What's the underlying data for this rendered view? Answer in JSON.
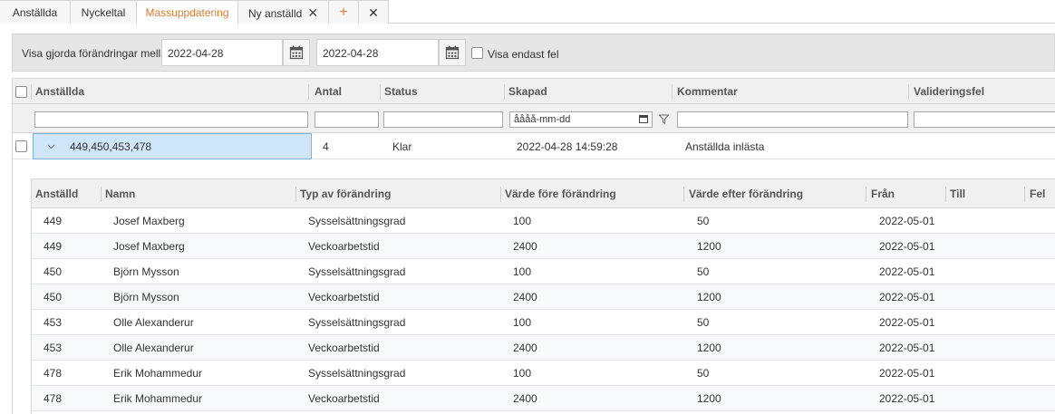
{
  "tabs": [
    {
      "label": "Anställda",
      "active": false,
      "closable": false
    },
    {
      "label": "Nyckeltal",
      "active": false,
      "closable": false
    },
    {
      "label": "Massuppdatering",
      "active": true,
      "closable": false
    },
    {
      "label": "Ny anställd",
      "active": false,
      "closable": true
    }
  ],
  "tab_add_symbol": "+",
  "tab_close_symbol": "✕",
  "filter": {
    "label": "Visa gjorda förändringar mellan",
    "from_date": "2022-04-28",
    "to_date": "2022-04-28",
    "only_errors_label": "Visa endast fel"
  },
  "grid": {
    "columns": [
      "Anställda",
      "Antal",
      "Status",
      "Skapad",
      "Kommentar",
      "Valideringsfel"
    ],
    "date_filter_placeholder": "åååå-mm-dd",
    "row": {
      "anstallda": "449,450,453,478",
      "antal": "4",
      "status": "Klar",
      "skapad": "2022-04-28 14:59:28",
      "kommentar": "Anställda inlästa",
      "valideringsfel": ""
    }
  },
  "subgrid": {
    "columns": [
      "Anställd",
      "Namn",
      "Typ av förändring",
      "Värde före förändring",
      "Värde efter förändring",
      "Från",
      "Till",
      "Fel"
    ],
    "rows": [
      [
        "449",
        "Josef Maxberg",
        "Sysselsättningsgrad",
        "100",
        "50",
        "2022-05-01",
        "",
        ""
      ],
      [
        "449",
        "Josef Maxberg",
        "Veckoarbetstid",
        "2400",
        "1200",
        "2022-05-01",
        "",
        ""
      ],
      [
        "450",
        "Björn Mysson",
        "Sysselsättningsgrad",
        "100",
        "50",
        "2022-05-01",
        "",
        ""
      ],
      [
        "450",
        "Björn Mysson",
        "Veckoarbetstid",
        "2400",
        "1200",
        "2022-05-01",
        "",
        ""
      ],
      [
        "453",
        "Olle Alexanderur",
        "Sysselsättningsgrad",
        "100",
        "50",
        "2022-05-01",
        "",
        ""
      ],
      [
        "453",
        "Olle Alexanderur",
        "Veckoarbetstid",
        "2400",
        "1200",
        "2022-05-01",
        "",
        ""
      ],
      [
        "478",
        "Erik Mohammedur",
        "Sysselsättningsgrad",
        "100",
        "50",
        "2022-05-01",
        "",
        ""
      ],
      [
        "478",
        "Erik Mohammedur",
        "Veckoarbetstid",
        "2400",
        "1200",
        "2022-05-01",
        "",
        ""
      ]
    ]
  },
  "colors": {
    "accent": "#e07a2e",
    "selection": "#cfe6f8",
    "selection_border": "#7bb3de"
  },
  "icons": [
    "close-icon",
    "add-icon",
    "calendar-icon",
    "checkbox-icon",
    "chevron-down-icon",
    "filter-icon"
  ]
}
